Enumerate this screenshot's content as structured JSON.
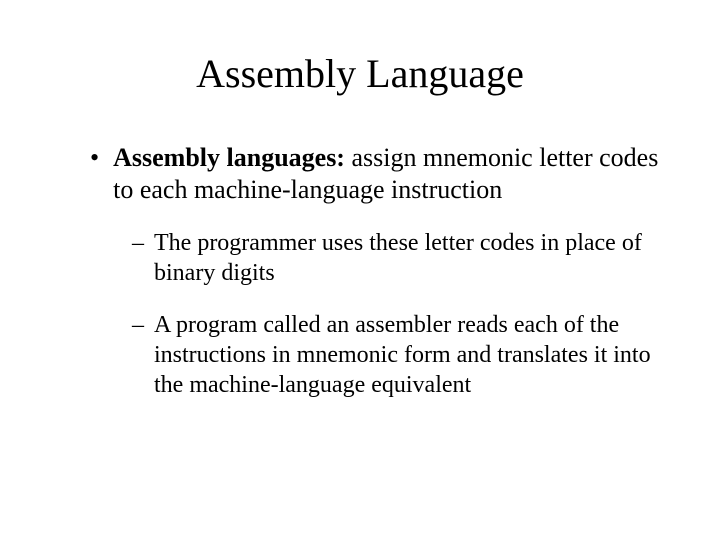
{
  "title": "Assembly Language",
  "main": {
    "term": "Assembly languages: ",
    "definition": "assign mnemonic letter codes to each machine-language instruction"
  },
  "subs": [
    "The programmer uses these letter codes in place of binary digits",
    "A program called an assembler reads each of the instructions in mnemonic form and translates it into the machine-language equivalent"
  ],
  "markers": {
    "bullet": "•",
    "dash": "–"
  }
}
